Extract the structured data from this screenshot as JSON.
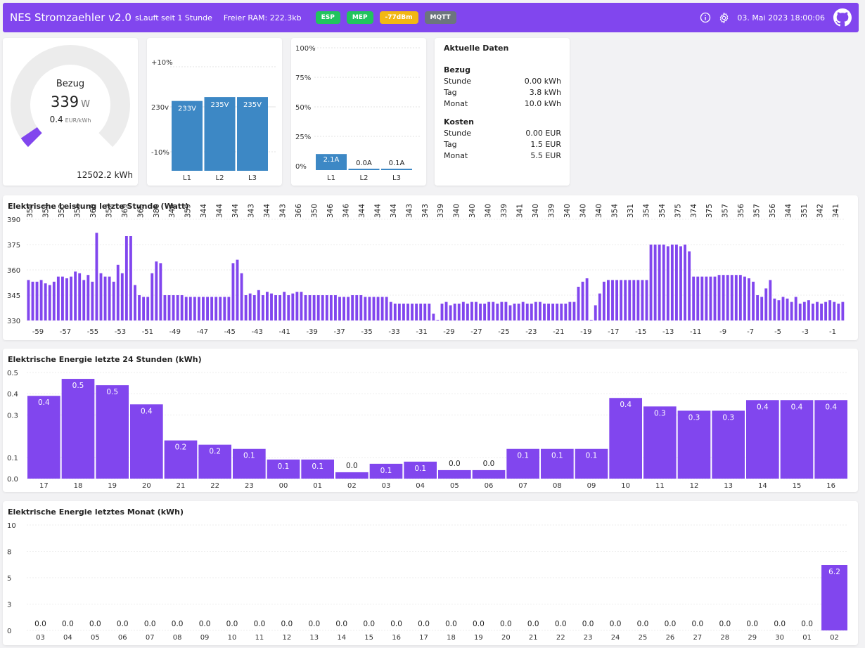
{
  "header": {
    "title": "NES Stromzaehler v2.0",
    "uptime": "sLauft seit 1 Stunde",
    "ram": "Freier RAM: 222.3kb",
    "badges": [
      {
        "label": "ESP",
        "color": "#21c45d"
      },
      {
        "label": "MEP",
        "color": "#21c45d"
      },
      {
        "label": "-77dBm",
        "color": "#f2b713"
      },
      {
        "label": "MQTT",
        "color": "#6c757d"
      }
    ],
    "datetime": "03. Mai 2023 18:00:06",
    "icons": [
      "info-icon",
      "gear-icon",
      "github-icon"
    ]
  },
  "gauge": {
    "label": "Bezug",
    "value": "339",
    "unit": "W",
    "price": "0.4",
    "price_unit": "EUR/kWh",
    "total": "12502.2 kWh",
    "fraction": 0.04,
    "color": "#8146ee"
  },
  "voltage": {
    "axis_labels": [
      "+10%",
      "230v",
      "-10%"
    ],
    "categories": [
      "L1",
      "L2",
      "L3"
    ],
    "values": [
      233,
      235,
      235
    ],
    "labels": [
      "233V",
      "235V",
      "235V"
    ],
    "color": "#3d88c5"
  },
  "current": {
    "axis_labels": [
      "100%",
      "75%",
      "50%",
      "25%",
      "0%"
    ],
    "categories": [
      "L1",
      "L2",
      "L3"
    ],
    "values": [
      2.1,
      0.0,
      0.1
    ],
    "labels": [
      "2.1A",
      "0.0A",
      "0.1A"
    ],
    "color": "#3d88c5"
  },
  "info": {
    "title": "Aktuelle Daten",
    "bezug": {
      "title": "Bezug",
      "rows": [
        {
          "label": "Stunde",
          "value": "0.00 kWh"
        },
        {
          "label": "Tag",
          "value": "3.8 kWh"
        },
        {
          "label": "Monat",
          "value": "10.0 kWh"
        }
      ]
    },
    "kosten": {
      "title": "Kosten",
      "rows": [
        {
          "label": "Stunde",
          "value": "0.00 EUR"
        },
        {
          "label": "Tag",
          "value": "1.5 EUR"
        },
        {
          "label": "Monat",
          "value": "5.5 EUR"
        }
      ]
    }
  },
  "chart_data": [
    {
      "type": "bar",
      "title": "Elektrische Leistung letzte Stunde (Watt)",
      "color": "#8146ee",
      "ylim": [
        330,
        390
      ],
      "yticks": [
        390,
        375,
        360,
        345,
        330
      ],
      "top_labels": [
        "355",
        "354",
        "353",
        "356",
        "360",
        "357",
        "369",
        "365",
        "380",
        "344",
        "359",
        "344",
        "344",
        "344",
        "343",
        "344",
        "343",
        "366",
        "350",
        "346",
        "346",
        "344",
        "344",
        "344",
        "343",
        "343",
        "339",
        "340",
        "340",
        "340",
        "339",
        "341",
        "340",
        "339",
        "340",
        "340",
        "340",
        "354",
        "331",
        "354",
        "354",
        "375",
        "374",
        "375",
        "357",
        "356",
        "357",
        "356",
        "344",
        "351",
        "342",
        "341"
      ],
      "x_ticks": [
        "-59",
        "-57",
        "-55",
        "-53",
        "-51",
        "-49",
        "-47",
        "-45",
        "-43",
        "-41",
        "-39",
        "-37",
        "-35",
        "-33",
        "-31",
        "-29",
        "-27",
        "-25",
        "-23",
        "-21",
        "-19",
        "-17",
        "-15",
        "-13",
        "-11",
        "-9",
        "-7",
        "-5",
        "-3",
        "-1"
      ],
      "values": [
        354,
        353,
        353,
        354,
        352,
        351,
        353,
        356,
        356,
        355,
        356,
        359,
        358,
        354,
        357,
        353,
        382,
        358,
        356,
        356,
        353,
        363,
        358,
        380,
        380,
        351,
        345,
        344,
        344,
        358,
        365,
        364,
        345,
        345,
        345,
        345,
        345,
        344,
        344,
        344,
        344,
        344,
        344,
        344,
        344,
        344,
        344,
        344,
        364,
        366,
        358,
        345,
        346,
        345,
        348,
        345,
        347,
        346,
        345,
        345,
        347,
        345,
        346,
        347,
        347,
        345,
        345,
        345,
        345,
        345,
        345,
        345,
        345,
        344,
        344,
        344,
        345,
        345,
        345,
        344,
        344,
        344,
        344,
        344,
        344,
        341,
        340,
        340,
        340,
        340,
        340,
        340,
        340,
        340,
        340,
        334,
        330,
        340,
        341,
        339,
        340,
        340,
        341,
        340,
        341,
        341,
        340,
        340,
        341,
        341,
        340,
        341,
        341,
        339,
        340,
        340,
        341,
        340,
        340,
        341,
        341,
        340,
        340,
        340,
        340,
        340,
        340,
        341,
        341,
        350,
        353,
        355,
        330,
        339,
        346,
        353,
        354,
        354,
        354,
        354,
        354,
        354,
        354,
        354,
        354,
        354,
        375,
        375,
        375,
        375,
        374,
        375,
        375,
        374,
        375,
        371,
        356,
        356,
        356,
        356,
        356,
        356,
        357,
        357,
        357,
        357,
        357,
        357,
        356,
        355,
        353,
        345,
        344,
        349,
        354,
        343,
        342,
        344,
        343,
        341,
        344,
        340,
        341,
        342,
        340,
        341,
        340,
        341,
        342,
        341,
        340,
        341
      ]
    },
    {
      "type": "bar",
      "title": "Elektrische Energie letzte 24 Stunden (kWh)",
      "color": "#8146ee",
      "ylim": [
        0,
        0.5
      ],
      "yticks": [
        "0.5",
        "0.4",
        "0.3",
        "0.1",
        "0.0"
      ],
      "ytick_values": [
        0.5,
        0.4,
        0.3,
        0.1,
        0.0
      ],
      "categories": [
        "17",
        "18",
        "19",
        "20",
        "21",
        "22",
        "23",
        "00",
        "01",
        "02",
        "03",
        "04",
        "05",
        "06",
        "07",
        "08",
        "09",
        "10",
        "11",
        "12",
        "13",
        "14",
        "15",
        "16"
      ],
      "values": [
        0.39,
        0.47,
        0.44,
        0.35,
        0.18,
        0.16,
        0.14,
        0.09,
        0.09,
        0.03,
        0.07,
        0.08,
        0.04,
        0.04,
        0.14,
        0.14,
        0.14,
        0.38,
        0.34,
        0.32,
        0.32,
        0.37,
        0.37,
        0.37
      ],
      "labels": [
        "0.4",
        "0.5",
        "0.5",
        "0.4",
        "0.2",
        "0.2",
        "0.1",
        "0.1",
        "0.1",
        "0.0",
        "0.1",
        "0.1",
        "0.0",
        "0.0",
        "0.1",
        "0.1",
        "0.1",
        "0.4",
        "0.3",
        "0.3",
        "0.3",
        "0.4",
        "0.4",
        "0.4"
      ]
    },
    {
      "type": "bar",
      "title": "Elektrische Energie letztes Monat (kWh)",
      "color": "#8146ee",
      "ylim": [
        0,
        10
      ],
      "yticks": [
        "10",
        "8",
        "5",
        "3",
        "0"
      ],
      "ytick_values": [
        10,
        7.5,
        5,
        2.5,
        0
      ],
      "categories": [
        "03",
        "04",
        "05",
        "06",
        "07",
        "08",
        "09",
        "10",
        "11",
        "12",
        "13",
        "14",
        "15",
        "16",
        "17",
        "18",
        "19",
        "20",
        "21",
        "22",
        "23",
        "24",
        "25",
        "26",
        "27",
        "28",
        "29",
        "30",
        "01",
        "02"
      ],
      "values": [
        0,
        0,
        0,
        0,
        0,
        0,
        0,
        0,
        0,
        0,
        0,
        0,
        0,
        0,
        0,
        0,
        0,
        0,
        0,
        0,
        0,
        0,
        0,
        0,
        0,
        0,
        0,
        0,
        0,
        6.2
      ],
      "labels": [
        "0.0",
        "0.0",
        "0.0",
        "0.0",
        "0.0",
        "0.0",
        "0.0",
        "0.0",
        "0.0",
        "0.0",
        "0.0",
        "0.0",
        "0.0",
        "0.0",
        "0.0",
        "0.0",
        "0.0",
        "0.0",
        "0.0",
        "0.0",
        "0.0",
        "0.0",
        "0.0",
        "0.0",
        "0.0",
        "0.0",
        "0.0",
        "0.0",
        "0.0",
        "6.2"
      ]
    }
  ]
}
